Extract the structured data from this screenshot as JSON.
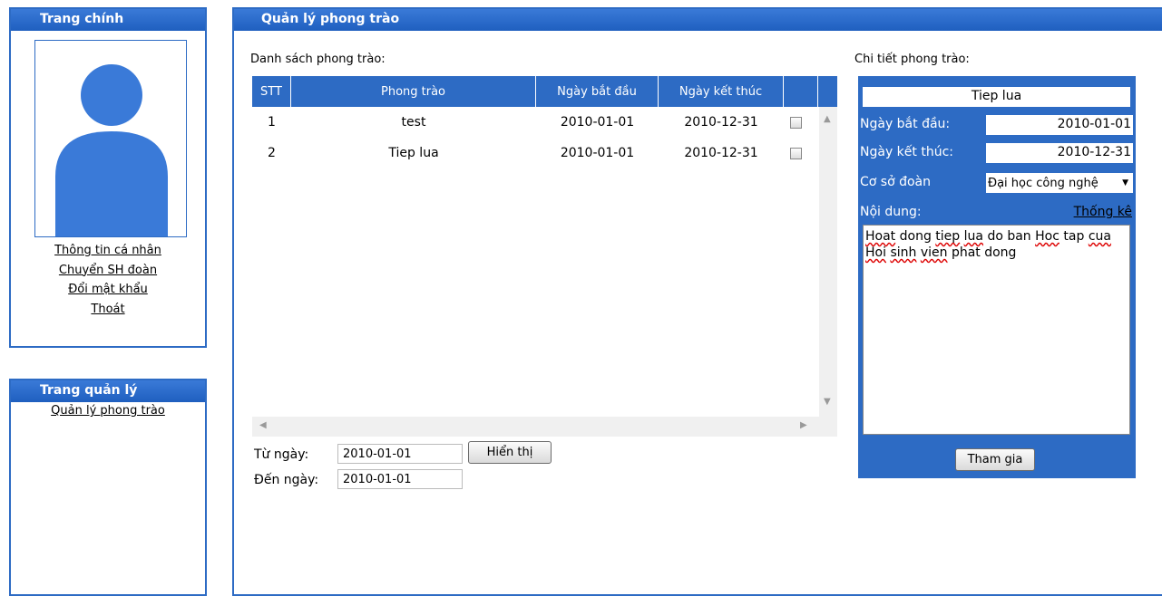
{
  "sidebar_main": {
    "title": "Trang chính",
    "links": [
      "Thông tin cá nhân",
      "Chuyển SH đoàn",
      "Đổi mật khẩu",
      "Thoát"
    ]
  },
  "sidebar_admin": {
    "title": "Trang quản lý",
    "links": [
      "Quản lý phong trào"
    ]
  },
  "main": {
    "title": "Quản lý phong trào",
    "list_label": "Danh sách phong trào:",
    "columns": [
      "STT",
      "Phong trào",
      "Ngày bắt đầu",
      "Ngày kết thúc"
    ],
    "rows": [
      {
        "stt": "1",
        "name": "test",
        "start": "2010-01-01",
        "end": "2010-12-31",
        "checked": false
      },
      {
        "stt": "2",
        "name": "Tiep lua",
        "start": "2010-01-01",
        "end": "2010-12-31",
        "checked": false
      }
    ],
    "filter": {
      "from_label": "Từ ngày:",
      "from_value": "2010-01-01",
      "to_label": "Đến ngày:",
      "to_value": "2010-01-01",
      "show_button": "Hiển thị"
    }
  },
  "detail": {
    "label": "Chi tiết phong trào:",
    "name": "Tiep lua",
    "start_label": "Ngày bắt đầu:",
    "start_value": "2010-01-01",
    "end_label": "Ngày kết thúc:",
    "end_value": "2010-12-31",
    "org_label": "Cơ sở đoàn",
    "org_value": "Đại học công nghệ",
    "content_label": "Nội dung:",
    "stats_link": "Thống kê",
    "content_words": [
      "Hoat",
      "dong",
      "tiep",
      "lua",
      "do",
      "ban",
      "Hoc",
      "tap",
      "cua",
      "Hoi",
      "sinh",
      "vien",
      "phat",
      "dong"
    ],
    "join_button": "Tham gia"
  },
  "colors": {
    "accent": "#2d6bc4",
    "header_gradient_top": "#3a7ad8",
    "avatar": "#3a7ad8"
  }
}
